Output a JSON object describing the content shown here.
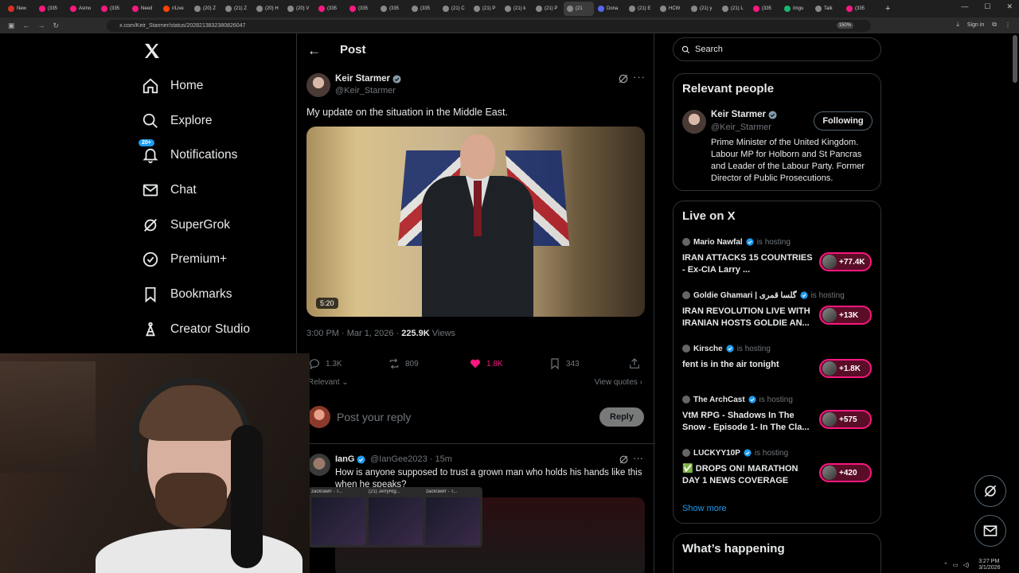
{
  "browser": {
    "tabs": [
      {
        "label": "New",
        "color": "#d93025"
      },
      {
        "label": "(335",
        "color": "#f91880"
      },
      {
        "label": "Asmo",
        "color": "#f91880"
      },
      {
        "label": "(335",
        "color": "#f91880"
      },
      {
        "label": "Need",
        "color": "#f91880"
      },
      {
        "label": "r/Live",
        "color": "#ff4500"
      },
      {
        "label": "(20) Z",
        "color": "#888888"
      },
      {
        "label": "(21) Z",
        "color": "#888888"
      },
      {
        "label": "(20) H",
        "color": "#888888"
      },
      {
        "label": "(20) V",
        "color": "#888888"
      },
      {
        "label": "(335",
        "color": "#f91880"
      },
      {
        "label": "(335",
        "color": "#f91880"
      },
      {
        "label": "(335",
        "color": "#888888"
      },
      {
        "label": "(335",
        "color": "#888888"
      },
      {
        "label": "(21) C",
        "color": "#888888"
      },
      {
        "label": "(21) P",
        "color": "#888888"
      },
      {
        "label": "(21) k",
        "color": "#888888"
      },
      {
        "label": "(21) P",
        "color": "#888888"
      },
      {
        "label": "(21",
        "color": "#888888",
        "active": true
      },
      {
        "label": "Dona",
        "color": "#5865f2"
      },
      {
        "label": "(21) E",
        "color": "#888888"
      },
      {
        "label": "HCW",
        "color": "#888888"
      },
      {
        "label": "(21) y",
        "color": "#888888"
      },
      {
        "label": "(21) L",
        "color": "#888888"
      },
      {
        "label": "(335",
        "color": "#f91880"
      },
      {
        "label": "Imgu",
        "color": "#1bb76e"
      },
      {
        "label": "Talk",
        "color": "#888888"
      },
      {
        "label": "(335",
        "color": "#f91880"
      }
    ],
    "url": "x.com/Keir_Starmer/status/2028213832380826047",
    "zoom": "150%",
    "signin": "Sign in"
  },
  "nav": {
    "items": [
      {
        "label": "Home",
        "icon": "home-icon"
      },
      {
        "label": "Explore",
        "icon": "search-icon"
      },
      {
        "label": "Notifications",
        "icon": "bell-icon",
        "badge": "20+"
      },
      {
        "label": "Chat",
        "icon": "mail-icon"
      },
      {
        "label": "SuperGrok",
        "icon": "grok-icon"
      },
      {
        "label": "Premium+",
        "icon": "premium-icon"
      },
      {
        "label": "Bookmarks",
        "icon": "bookmark-icon"
      },
      {
        "label": "Creator Studio",
        "icon": "creator-studio-icon"
      }
    ]
  },
  "post": {
    "header": "Post",
    "author_name": "Keir Starmer",
    "author_handle": "@Keir_Starmer",
    "text": "My update on the situation in the Middle East.",
    "video_duration": "5:20",
    "timestamp": "3:00 PM · Mar 1, 2026 · ",
    "views": "225.9K",
    "views_label": " Views",
    "replies": "1.3K",
    "reposts": "809",
    "likes": "1.8K",
    "bookmarks": "343",
    "sort_label": "Relevant ⌄",
    "view_quotes": "View quotes ›",
    "reply_placeholder": "Post your reply",
    "reply_button": "Reply"
  },
  "comment": {
    "name": "IanG",
    "handle": "@IanGee2023 · 15m",
    "text": "How is anyone supposed to trust a grown man who holds his hands like this when he speaks?"
  },
  "taskbar_previews": [
    {
      "label": "zackrawrr - T..."
    },
    {
      "label": "(21) JerryRig..."
    },
    {
      "label": "zackrawrr - T..."
    }
  ],
  "search": {
    "placeholder": "Search"
  },
  "relevant_people": {
    "title": "Relevant people",
    "name": "Keir Starmer",
    "handle": "@Keir_Starmer",
    "button": "Following",
    "bio": "Prime Minister of the United Kingdom. Labour MP for Holborn and St Pancras and Leader of the Labour Party. Former Director of Public Prosecutions."
  },
  "live": {
    "title": "Live on X",
    "items": [
      {
        "host": "Mario Nawfal",
        "emoji": "",
        "hosting": "is hosting",
        "title": "IRAN ATTACKS 15 COUNTRIES - Ex-CIA Larry ...",
        "count": "+77.4K"
      },
      {
        "host": "Goldie Ghamari | گلسا قمری",
        "emoji": "",
        "hosting": "is hosting",
        "title": "IRAN REVOLUTION LIVE WITH IRANIAN HOSTS GOLDIE AN...",
        "count": "+13K"
      },
      {
        "host": "Kirsche",
        "emoji": "",
        "hosting": "is hosting",
        "title": "fent is in the air tonight",
        "count": "+1.8K"
      },
      {
        "host": "The ArchCast",
        "emoji": "",
        "hosting": "is hosting",
        "title": "VtM RPG - Shadows In The Snow - Episode 1- In The Cla...",
        "count": "+575"
      },
      {
        "host": "LUCKYY10P",
        "emoji": "",
        "hosting": "is hosting",
        "title": "✅ DROPS ON! MARATHON DAY 1 NEWS COVERAGE",
        "count": "+420"
      }
    ],
    "show_more": "Show more"
  },
  "happening": {
    "title": "What’s happening"
  },
  "tray": {
    "time": "3:27 PM",
    "date": "3/1/2026"
  },
  "colors": {
    "accent": "#1d9bf0",
    "like": "#f91880",
    "border": "#2f3336",
    "muted": "#71767b"
  }
}
